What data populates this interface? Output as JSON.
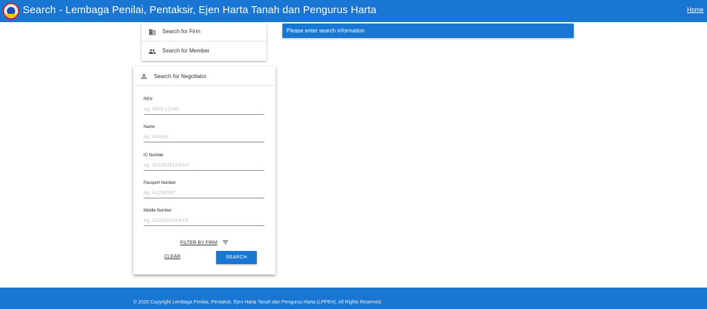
{
  "header": {
    "title": "Search - Lembaga Penilai, Pentaksir, Ejen Harta Tanah dan Pengurus Harta",
    "home_link": "Home",
    "logo_icon": "lppeh-logo",
    "color": "#1976d2"
  },
  "menu": {
    "items": [
      {
        "label": "Search for Firm",
        "icon": "building-icon"
      },
      {
        "label": "Search for Member",
        "icon": "people-icon"
      }
    ]
  },
  "info": {
    "message": "Please enter search information."
  },
  "negotiator_form": {
    "header_label": "Search for Negotiator",
    "header_icon": "person-icon",
    "fields": [
      {
        "label": "REN",
        "placeholder": "eg. REN 12345",
        "value": ""
      },
      {
        "label": "Name",
        "placeholder": "eg. Ahmad",
        "value": ""
      },
      {
        "label": "IC Number",
        "placeholder": "eg. 92100311XXXX",
        "value": ""
      },
      {
        "label": "Passport Number",
        "placeholder": "eg. A1234567",
        "value": ""
      },
      {
        "label": "Mobile Number",
        "placeholder": "eg. 013XXXXXXXX",
        "value": ""
      }
    ],
    "filter_label": "FILTER BY FIRM",
    "filter_icon": "filter-icon",
    "clear_label": "CLEAR",
    "search_label": "SEARCH"
  },
  "footer": {
    "copyright": "© 2020 Copyright Lembaga Penilai, Pentaksir, Ejen Harta Tanah dan Pengurus Harta (LPPEH). All Rights Reserved."
  }
}
